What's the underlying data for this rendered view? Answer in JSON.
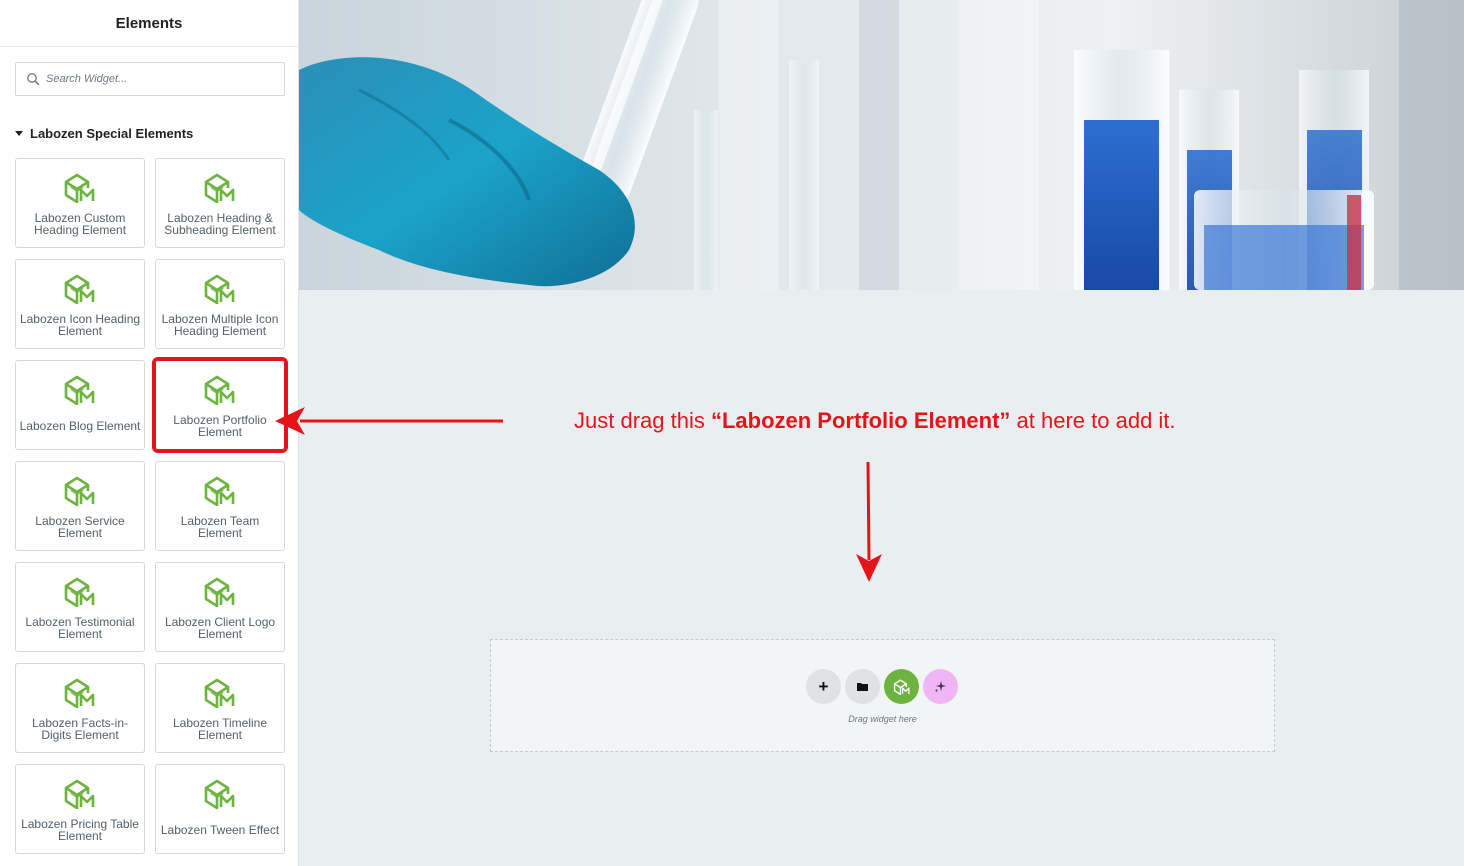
{
  "sidebar": {
    "title": "Elements",
    "search_placeholder": "Search Widget...",
    "category": "Labozen Special Elements",
    "tiles": [
      {
        "label": "Labozen Custom Heading Element"
      },
      {
        "label": "Labozen Heading & Subheading Element"
      },
      {
        "label": "Labozen Icon Heading Element"
      },
      {
        "label": "Labozen Multiple Icon Heading Element"
      },
      {
        "label": "Labozen Blog Element"
      },
      {
        "label": "Labozen Portfolio Element"
      },
      {
        "label": "Labozen Service Element"
      },
      {
        "label": "Labozen Team Element"
      },
      {
        "label": "Labozen Testimonial Element"
      },
      {
        "label": "Labozen Client Logo Element"
      },
      {
        "label": "Labozen Facts-in-Digits Element"
      },
      {
        "label": "Labozen Timeline Element"
      },
      {
        "label": "Labozen Pricing Table Element"
      },
      {
        "label": "Labozen Tween Effect"
      }
    ],
    "highlighted_tile": "Labozen Portfolio Element"
  },
  "annotation": {
    "prefix": "Just drag this ",
    "bold": "“Labozen Portfolio Element”",
    "suffix": " at here to add it."
  },
  "drop_zone": {
    "add_icon": "+",
    "hint": "Drag widget here"
  },
  "colors": {
    "annotation_red": "#e6141a",
    "brand_green": "#6db33f",
    "ai_pink": "#efb5f5",
    "canvas_bg": "#e9eff1"
  },
  "icons": {
    "search": "search-icon",
    "tile": "labozen-logo-icon",
    "collapse": "chevron-left-icon",
    "folder": "folder-icon",
    "ai": "sparkle-icon"
  }
}
